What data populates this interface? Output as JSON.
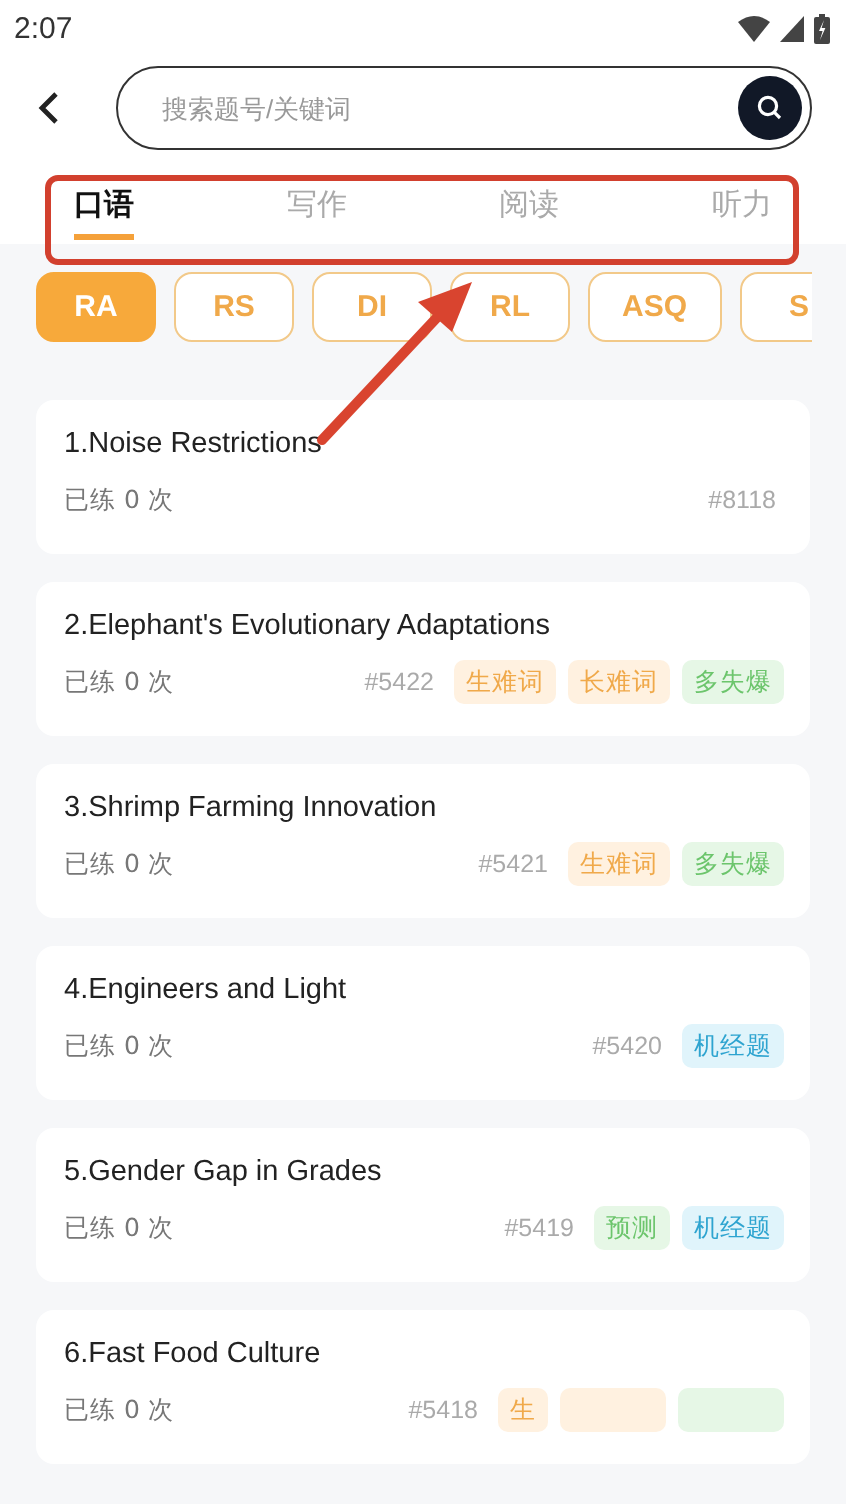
{
  "status_bar": {
    "time": "2:07"
  },
  "search": {
    "placeholder": "搜索题号/关键词"
  },
  "tabs": [
    {
      "label": "口语",
      "selected": true
    },
    {
      "label": "写作",
      "selected": false
    },
    {
      "label": "阅读",
      "selected": false
    },
    {
      "label": "听力",
      "selected": false
    }
  ],
  "chips": [
    {
      "label": "RA",
      "selected": true
    },
    {
      "label": "RS",
      "selected": false
    },
    {
      "label": "DI",
      "selected": false
    },
    {
      "label": "RL",
      "selected": false
    },
    {
      "label": "ASQ",
      "selected": false
    },
    {
      "label": "S",
      "selected": false
    }
  ],
  "questions": [
    {
      "title": "1.Noise Restrictions",
      "practice": "已练 0 次",
      "number": "#8118"
    },
    {
      "title": "2.Elephant's Evolutionary Adaptations",
      "practice": "已练 0 次",
      "number": "#5422",
      "tags": [
        {
          "label": "生难词",
          "kind": "orange"
        },
        {
          "label": "长难词",
          "kind": "orange"
        },
        {
          "label": "多失爆",
          "kind": "green"
        }
      ]
    },
    {
      "title": "3.Shrimp Farming Innovation",
      "practice": "已练 0 次",
      "number": "#5421",
      "tags": [
        {
          "label": "生难词",
          "kind": "orange"
        },
        {
          "label": "多失爆",
          "kind": "green"
        }
      ]
    },
    {
      "title": "4.Engineers and Light",
      "practice": "已练 0 次",
      "number": "#5420",
      "tags": [
        {
          "label": "机经题",
          "kind": "blue"
        }
      ]
    },
    {
      "title": "5.Gender Gap in Grades",
      "practice": "已练 0 次",
      "number": "#5419",
      "tags": [
        {
          "label": "预测",
          "kind": "green"
        },
        {
          "label": "机经题",
          "kind": "blue"
        }
      ]
    },
    {
      "title": "6.Fast Food Culture",
      "practice": "已练 0 次",
      "number": "#5418",
      "tags": [
        {
          "label": "生",
          "kind": "orange"
        },
        {
          "kind": "orange"
        },
        {
          "kind": "green"
        }
      ]
    }
  ]
}
